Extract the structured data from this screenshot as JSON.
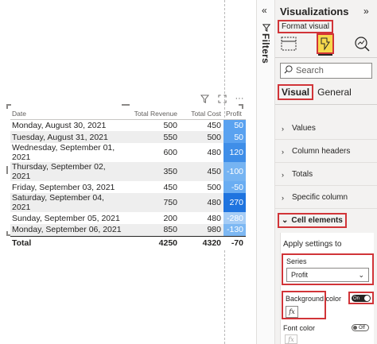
{
  "matrix": {
    "headers": [
      "Date",
      "Total Revenue",
      "Total Cost",
      "Profit"
    ],
    "rows": [
      {
        "date": "Monday, August 30, 2021",
        "revenue": "500",
        "cost": "450",
        "profit": "50",
        "profit_color": "#5aa2f0"
      },
      {
        "date": "Tuesday, August 31, 2021",
        "revenue": "550",
        "cost": "500",
        "profit": "50",
        "profit_color": "#5aa2f0"
      },
      {
        "date": "Wednesday, September 01, 2021",
        "revenue": "600",
        "cost": "480",
        "profit": "120",
        "profit_color": "#3f8ee8"
      },
      {
        "date": "Thursday, September 02, 2021",
        "revenue": "350",
        "cost": "450",
        "profit": "-100",
        "profit_color": "#76b4f2"
      },
      {
        "date": "Friday, September 03, 2021",
        "revenue": "450",
        "cost": "500",
        "profit": "-50",
        "profit_color": "#6aadf2"
      },
      {
        "date": "Saturday, September 04, 2021",
        "revenue": "750",
        "cost": "480",
        "profit": "270",
        "profit_color": "#1f74df"
      },
      {
        "date": "Sunday, September 05, 2021",
        "revenue": "200",
        "cost": "480",
        "profit": "-280",
        "profit_color": "#a6cdf6"
      },
      {
        "date": "Monday, September 06, 2021",
        "revenue": "850",
        "cost": "980",
        "profit": "-130",
        "profit_color": "#7db8f3"
      }
    ],
    "total": {
      "label": "Total",
      "revenue": "4250",
      "cost": "4320",
      "profit": "-70"
    }
  },
  "filters": {
    "label": "Filters"
  },
  "viz_pane": {
    "title": "Visualizations",
    "format_visual_label": "Format visual",
    "search_placeholder": "Search",
    "tab_visual": "Visual",
    "tab_general": "General",
    "sections": [
      "Values",
      "Column headers",
      "Totals",
      "Specific column"
    ],
    "cell_elements": "Cell elements",
    "apply_settings_to": "Apply settings to",
    "series_label": "Series",
    "series_value": "Profit",
    "background_color": "Background color",
    "toggle_on": "On",
    "font_color": "Font color",
    "toggle_off": "Off",
    "fx": "fx"
  }
}
